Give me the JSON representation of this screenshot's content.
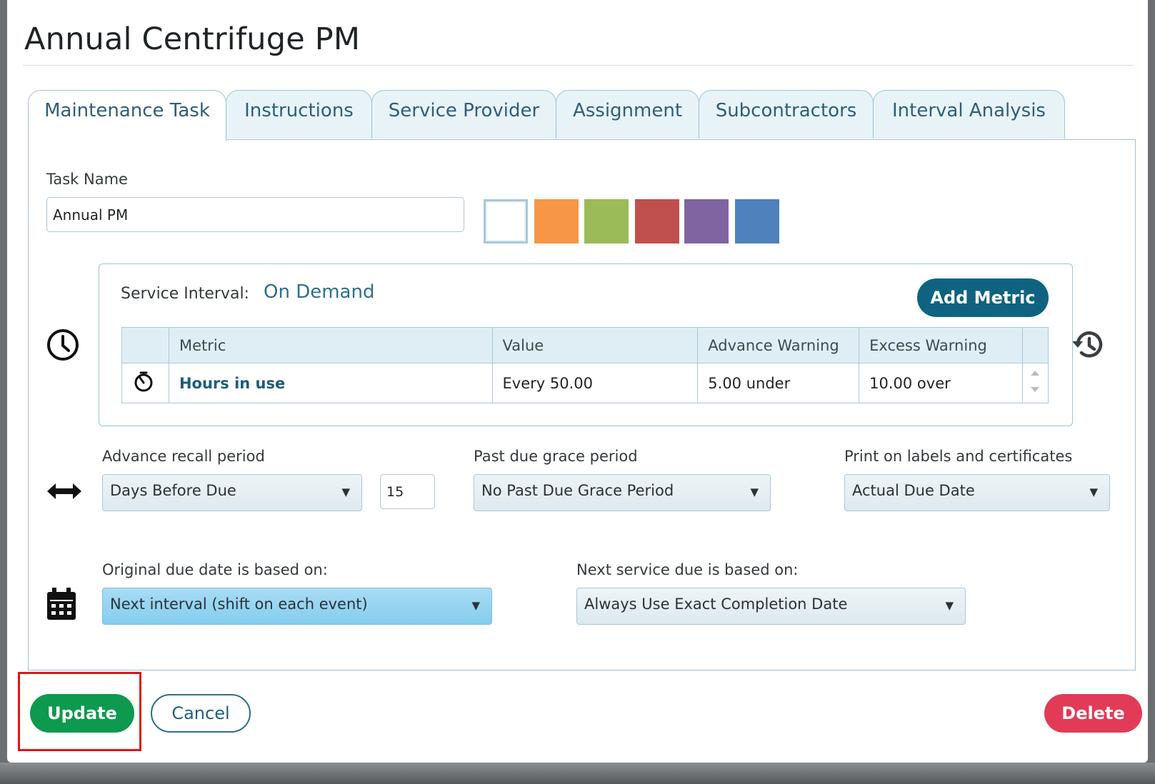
{
  "dialog": {
    "title": "Annual Centrifuge PM"
  },
  "tabs": [
    {
      "label": "Maintenance Task",
      "active": true
    },
    {
      "label": "Instructions"
    },
    {
      "label": "Service Provider"
    },
    {
      "label": "Assignment"
    },
    {
      "label": "Subcontractors"
    },
    {
      "label": "Interval Analysis"
    }
  ],
  "task": {
    "name_label": "Task Name",
    "name_value": "Annual PM",
    "colors": [
      "#ffffff",
      "#f79646",
      "#9bbb59",
      "#c0504d",
      "#8064a2",
      "#4f81bd"
    ],
    "selected_color": "#ffffff"
  },
  "service_interval": {
    "label": "Service Interval:",
    "value": "On Demand",
    "add_metric_label": "Add Metric",
    "columns": [
      "Metric",
      "Value",
      "Advance Warning",
      "Excess Warning"
    ],
    "rows": [
      {
        "metric": "Hours in use",
        "value": "Every 50.00",
        "advance": "5.00 under",
        "excess": "10.00 over"
      }
    ]
  },
  "recall": {
    "advance_label": "Advance recall period",
    "advance_select": "Days Before Due",
    "advance_days": "15",
    "grace_label": "Past due grace period",
    "grace_select": "No Past Due Grace Period",
    "print_label": "Print on labels and certificates",
    "print_select": "Actual Due Date"
  },
  "due": {
    "original_label": "Original due date is based on:",
    "original_select": "Next interval (shift on each event)",
    "next_label": "Next service due is based on:",
    "next_select": "Always Use Exact Completion Date"
  },
  "actions": {
    "update": "Update",
    "cancel": "Cancel",
    "delete": "Delete"
  },
  "icons": [
    "clock-icon",
    "history-icon",
    "stopwatch-icon",
    "arrows-horizontal-icon",
    "calendar-icon",
    "chevron-down-icon"
  ]
}
